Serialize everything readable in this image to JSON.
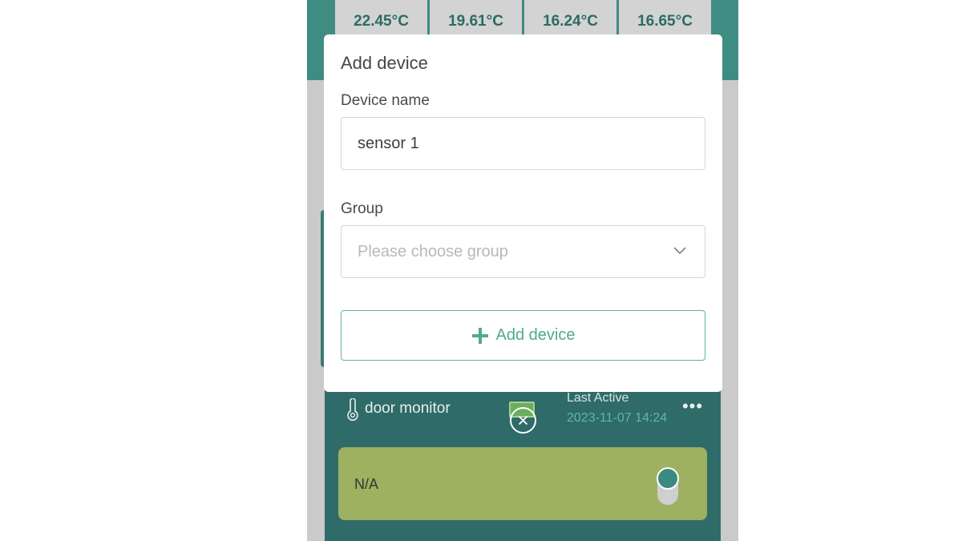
{
  "temperatures": [
    "22.45°C",
    "19.61°C",
    "16.24°C",
    "16.65°C"
  ],
  "device_card": {
    "name": "door monitor",
    "icon": "thermometer-icon",
    "last_active_label": "Last Active",
    "last_active_time": "2023-11-07 14:24",
    "more_label": "•••",
    "reading": "N/A"
  },
  "dialog": {
    "title": "Add device",
    "device_name_label": "Device name",
    "device_name_value": "sensor 1",
    "group_label": "Group",
    "group_placeholder": "Please choose group",
    "submit_label": "Add device"
  },
  "colors": {
    "accent": "#4eaa96",
    "header": "#3f8c82",
    "card": "#2f6b68",
    "reading_panel": "#9db160"
  }
}
